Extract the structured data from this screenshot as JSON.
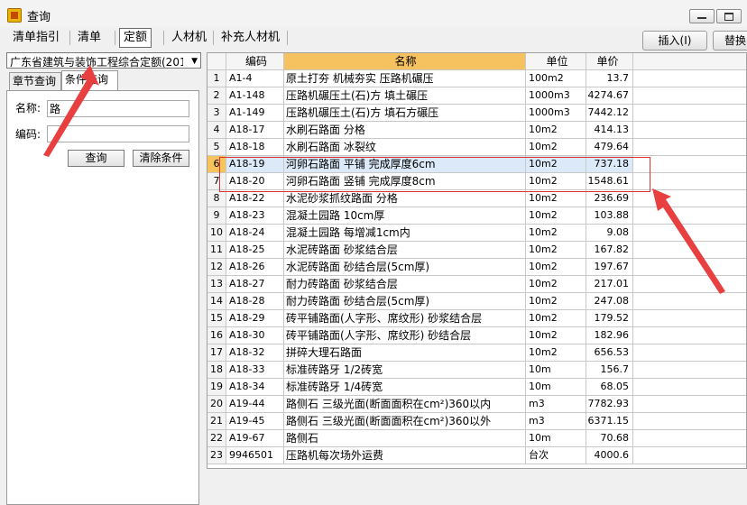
{
  "window": {
    "title": "查询"
  },
  "toolbar": {
    "tabs": [
      "清单指引",
      "清单",
      "定额",
      "人材机",
      "补充人材机"
    ],
    "insert_label": "插入(I)",
    "replace_label": "替换"
  },
  "left": {
    "combo_value": "广东省建筑与装饰工程综合定额(201",
    "subtabs": [
      "章节查询",
      "条件查询"
    ],
    "name_label": "名称:",
    "name_value": "路",
    "code_label": "编码:",
    "code_value": "",
    "query_label": "查询",
    "clear_label": "清除条件"
  },
  "table": {
    "headers": [
      "",
      "编码",
      "名称",
      "单位",
      "单价"
    ],
    "rows": [
      {
        "n": "1",
        "code": "A1-4",
        "name": "原土打夯 机械夯实 压路机碾压",
        "unit": "100m2",
        "price": "13.7"
      },
      {
        "n": "2",
        "code": "A1-148",
        "name": "压路机碾压土(石)方 填土碾压",
        "unit": "1000m3",
        "price": "4274.67"
      },
      {
        "n": "3",
        "code": "A1-149",
        "name": "压路机碾压土(石)方 填石方碾压",
        "unit": "1000m3",
        "price": "7442.12"
      },
      {
        "n": "4",
        "code": "A18-17",
        "name": "水刷石路面 分格",
        "unit": "10m2",
        "price": "414.13"
      },
      {
        "n": "5",
        "code": "A18-18",
        "name": "水刷石路面 冰裂纹",
        "unit": "10m2",
        "price": "479.64"
      },
      {
        "n": "6",
        "code": "A18-19",
        "name": "河卵石路面 平铺 完成厚度6cm",
        "unit": "10m2",
        "price": "737.18"
      },
      {
        "n": "7",
        "code": "A18-20",
        "name": "河卵石路面 竖铺 完成厚度8cm",
        "unit": "10m2",
        "price": "1548.61"
      },
      {
        "n": "8",
        "code": "A18-22",
        "name": "水泥砂浆抓纹路面 分格",
        "unit": "10m2",
        "price": "236.69"
      },
      {
        "n": "9",
        "code": "A18-23",
        "name": "混凝土园路 10cm厚",
        "unit": "10m2",
        "price": "103.88"
      },
      {
        "n": "10",
        "code": "A18-24",
        "name": "混凝土园路 每增减1cm内",
        "unit": "10m2",
        "price": "9.08"
      },
      {
        "n": "11",
        "code": "A18-25",
        "name": "水泥砖路面 砂浆结合层",
        "unit": "10m2",
        "price": "167.82"
      },
      {
        "n": "12",
        "code": "A18-26",
        "name": "水泥砖路面 砂结合层(5cm厚)",
        "unit": "10m2",
        "price": "197.67"
      },
      {
        "n": "13",
        "code": "A18-27",
        "name": "耐力砖路面 砂浆结合层",
        "unit": "10m2",
        "price": "217.01"
      },
      {
        "n": "14",
        "code": "A18-28",
        "name": "耐力砖路面 砂结合层(5cm厚)",
        "unit": "10m2",
        "price": "247.08"
      },
      {
        "n": "15",
        "code": "A18-29",
        "name": "砖平铺路面(人字形、席纹形) 砂浆结合层",
        "unit": "10m2",
        "price": "179.52"
      },
      {
        "n": "16",
        "code": "A18-30",
        "name": "砖平铺路面(人字形、席纹形) 砂结合层",
        "unit": "10m2",
        "price": "182.96"
      },
      {
        "n": "17",
        "code": "A18-32",
        "name": "拼碎大理石路面",
        "unit": "10m2",
        "price": "656.53"
      },
      {
        "n": "18",
        "code": "A18-33",
        "name": "标准砖路牙 1/2砖宽",
        "unit": "10m",
        "price": "156.7"
      },
      {
        "n": "19",
        "code": "A18-34",
        "name": "标准砖路牙 1/4砖宽",
        "unit": "10m",
        "price": "68.05"
      },
      {
        "n": "20",
        "code": "A19-44",
        "name": "路侧石 三级光面(断面面积在cm²)360以内",
        "unit": "m3",
        "price": "7782.93"
      },
      {
        "n": "21",
        "code": "A19-45",
        "name": "路侧石 三级光面(断面面积在cm²)360以外",
        "unit": "m3",
        "price": "6371.15"
      },
      {
        "n": "22",
        "code": "A19-67",
        "name": "路侧石",
        "unit": "10m",
        "price": "70.68"
      },
      {
        "n": "23",
        "code": "9946501",
        "name": "压路机每次场外运费",
        "unit": "台次",
        "price": "4000.6"
      }
    ]
  }
}
